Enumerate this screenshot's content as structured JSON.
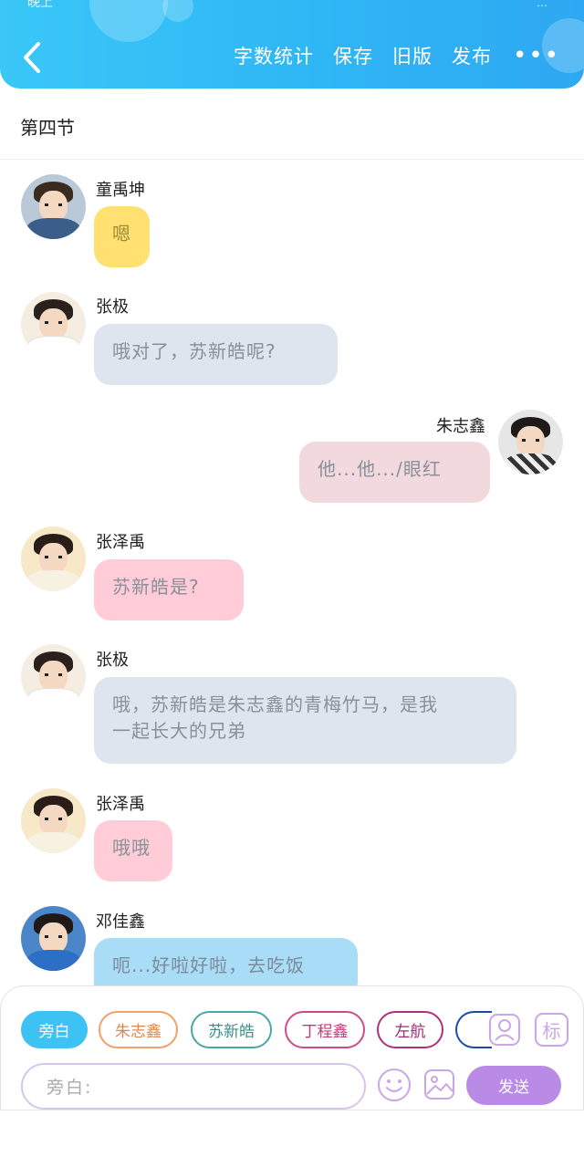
{
  "status_bar": {
    "left": "晚上",
    "right": "…"
  },
  "header": {
    "actions": [
      "字数统计",
      "保存",
      "旧版",
      "发布"
    ],
    "more": "•••"
  },
  "section_title": "第四节",
  "messages": [
    {
      "speaker": "童禹坤",
      "text": "嗯"
    },
    {
      "speaker": "张极",
      "text": "哦对了，苏新皓呢?"
    },
    {
      "speaker": "朱志鑫",
      "text": "他...他.../眼红"
    },
    {
      "speaker": "张泽禹",
      "text": "苏新皓是?"
    },
    {
      "speaker": "张极",
      "text": "哦，苏新皓是朱志鑫的青梅竹马，是我一起长大的兄弟",
      "text_line1": "哦，苏新皓是朱志鑫的青梅竹马，是我",
      "text_line2": "一起长大的兄弟"
    },
    {
      "speaker": "张泽禹",
      "text": "哦哦"
    },
    {
      "speaker": "邓佳鑫",
      "text": "呃...好啦好啦，去吃饭"
    }
  ],
  "roles": [
    {
      "label": "旁白",
      "color": "#3cc3f3",
      "active": true
    },
    {
      "label": "朱志鑫",
      "color": "#f0a06a",
      "active": false
    },
    {
      "label": "苏新皓",
      "color": "#4aa7a7",
      "active": false
    },
    {
      "label": "丁程鑫",
      "color": "#d04a8a",
      "active": false
    },
    {
      "label": "左航",
      "color": "#b0307a",
      "active": false
    }
  ],
  "tools": {
    "tag_label": "标"
  },
  "input": {
    "prefix": "旁白:"
  },
  "send_label": "发送"
}
